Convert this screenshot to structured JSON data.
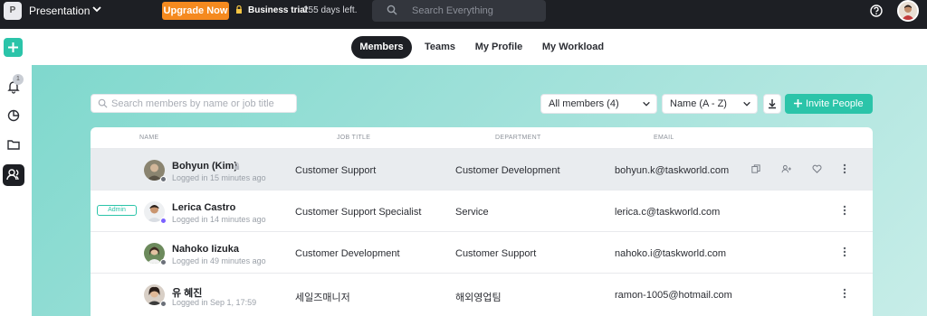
{
  "topbar": {
    "workspace_initial": "P",
    "workspace_name": "Presentation",
    "upgrade_label": "Upgrade Now",
    "trial_label": "Business trial",
    "trial_days": "255 days left.",
    "search_placeholder": "Search Everything"
  },
  "sidebar": {
    "notification_count": "1",
    "items": [
      "plus-icon",
      "bell-icon",
      "pie-chart-icon",
      "folder-icon",
      "people-icon"
    ]
  },
  "tabs": [
    {
      "label": "Members",
      "active": true
    },
    {
      "label": "Teams",
      "active": false
    },
    {
      "label": "My Profile",
      "active": false
    },
    {
      "label": "My Workload",
      "active": false
    }
  ],
  "toolbar": {
    "search_placeholder": "Search members by name or job title",
    "filter_value": "All members (4)",
    "sort_value": "Name (A - Z)",
    "invite_label": "Invite People"
  },
  "table": {
    "headers": [
      "NAME",
      "JOB TITLE",
      "DEPARTMENT",
      "EMAIL"
    ],
    "rows": [
      {
        "name": "Bohyun (Kim)",
        "login": "Logged in 15 minutes ago",
        "job": "Customer Support",
        "dept": "Customer Development",
        "email": "bohyun.k@taskworld.com",
        "badge": "",
        "status_color": "#6b7079"
      },
      {
        "name": "Lerica Castro",
        "login": "Logged in 14 minutes ago",
        "job": "Customer Support Specialist",
        "dept": "Service",
        "email": "lerica.c@taskworld.com",
        "badge": "Admin",
        "status_color": "#7b61ff"
      },
      {
        "name": "Nahoko Iizuka",
        "login": "Logged in 49 minutes ago",
        "job": "Customer Development",
        "dept": "Customer Support",
        "email": "nahoko.i@taskworld.com",
        "badge": "",
        "status_color": "#6b7079"
      },
      {
        "name": "유 혜진",
        "login": "Logged in Sep 1, 17:59",
        "job": "세일즈매니저",
        "dept": "해외영업팀",
        "email": "ramon-1005@hotmail.com",
        "badge": "",
        "status_color": "#6b7079"
      }
    ]
  },
  "colors": {
    "accent": "#2bc4a9",
    "upgrade": "#f58a1f",
    "topbar": "#1d1f24"
  }
}
